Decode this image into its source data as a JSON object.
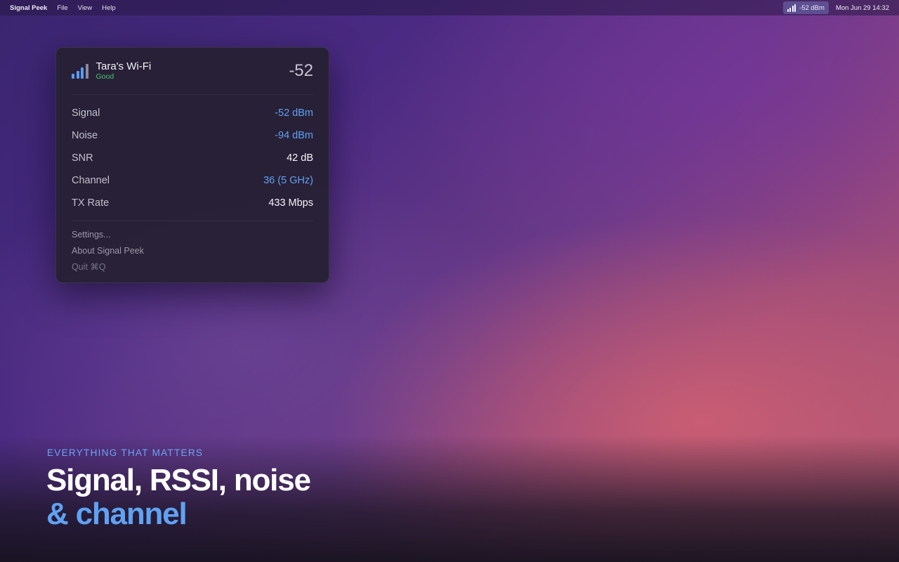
{
  "menubar": {
    "app_name": "Signal Peek",
    "menus": [
      "File",
      "View",
      "Help"
    ],
    "status_item": {
      "icon": "signal-bars-icon",
      "text": "-52 dBm"
    },
    "clock": "Mon Jun 29 14:32"
  },
  "panel": {
    "header": {
      "icon": "signal-bars-icon",
      "network_name": "Tara's Wi-Fi",
      "quality": "Good",
      "rssi": "-52"
    },
    "rows": [
      {
        "label": "Signal",
        "value": "-52 dBm",
        "accent": true
      },
      {
        "label": "Noise",
        "value": "-94 dBm",
        "accent": true
      },
      {
        "label": "SNR",
        "value": "42 dB",
        "accent": false
      },
      {
        "label": "Channel",
        "value": "36 (5 GHz)",
        "accent": true
      },
      {
        "label": "TX Rate",
        "value": "433 Mbps",
        "accent": false
      }
    ],
    "menu": {
      "settings": "Settings...",
      "about": "About Signal Peek",
      "quit": "Quit ⌘Q"
    }
  },
  "hero": {
    "eyebrow": "EVERYTHING THAT MATTERS",
    "headline_line1": "Signal, RSSI, noise",
    "headline_line2": "& channel"
  },
  "colors": {
    "accent": "#5fa2f2",
    "good": "#4cc86a"
  }
}
